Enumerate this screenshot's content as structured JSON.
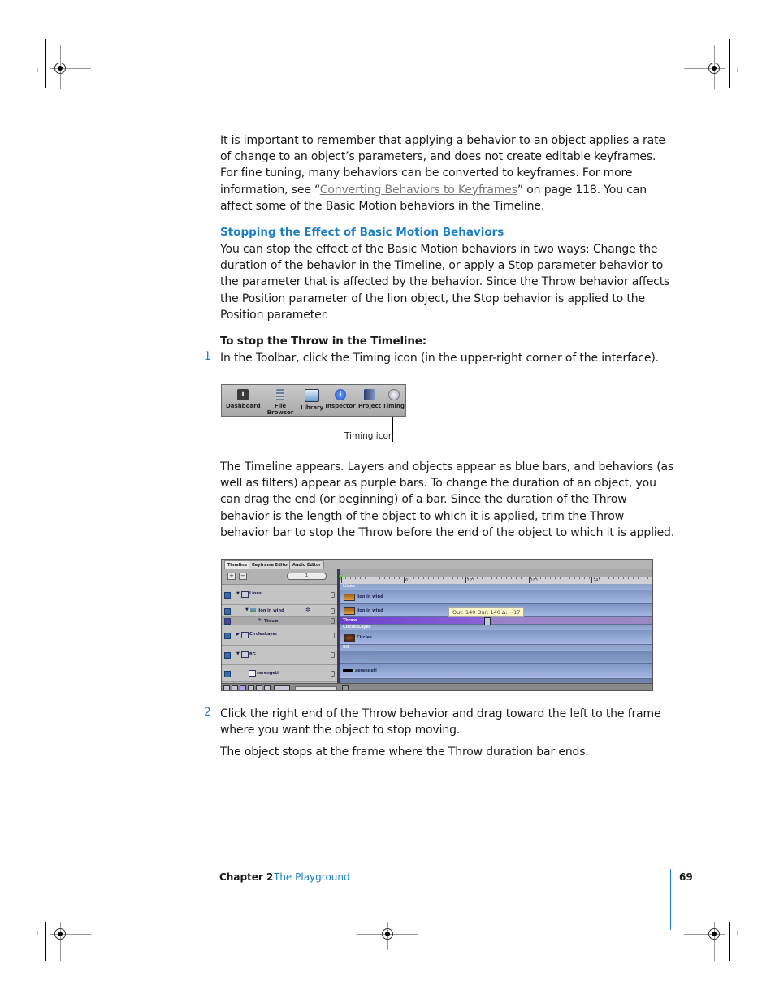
{
  "intro_paragraph": {
    "before_link": "It is important to remember that applying a behavior to an object applies a rate of change to an object’s parameters, and does not create editable keyframes. For fine tuning, many behaviors can be converted to keyframes. For more information, see “",
    "link_text": "Converting Behaviors to Keyframes",
    "after_link": "” on page 118. You can affect some of the Basic Motion behaviors in the Timeline."
  },
  "section_heading": "Stopping the Effect of Basic Motion Behaviors",
  "section_paragraph": "You can stop the effect of the Basic Motion behaviors in two ways:  Change the duration of the behavior in the Timeline, or apply a Stop parameter behavior to the parameter that is affected by the behavior. Since the Throw behavior affects the Position parameter of the lion object, the Stop behavior is applied to the Position parameter.",
  "procedure_heading": "To stop the Throw in the Timeline:",
  "steps": [
    {
      "number": "1",
      "text": "In the Toolbar, click the Timing icon (in the upper-right corner of the interface)."
    },
    {
      "number": "2",
      "text": "Click the right end of the Throw behavior and drag toward the left to the frame where you want the object to stop moving."
    }
  ],
  "toolbar_figure": {
    "items": [
      {
        "label": "Dashboard",
        "icon": "dashboard-icon",
        "color": "#3a3a3a"
      },
      {
        "label": "File Browser",
        "icon": "file-browser-icon",
        "color": "#5a6a8a"
      },
      {
        "label": "Library",
        "icon": "library-icon",
        "color": "#6a9ac8"
      },
      {
        "label": "Inspector",
        "icon": "inspector-icon",
        "color": "#2a62c8"
      },
      {
        "label": "Project",
        "icon": "project-icon",
        "color": "#3a4a7a"
      },
      {
        "label": "Timing",
        "icon": "timing-icon",
        "color": "#d0d0d8"
      }
    ],
    "callout": "Timing icon"
  },
  "timeline_paragraph": "The Timeline appears. Layers and objects appear as blue bars, and behaviors (as well as filters) appear as purple bars. To change the duration of an object, you can drag the end (or beginning) of a bar. Since the duration of the Throw behavior is the length of the object to which it is applied, trim the Throw behavior bar to stop the Throw before the end of the object to which it is applied.",
  "timeline_figure": {
    "tabs": [
      "Timeline",
      "Keyframe Editor",
      "Audio Editor"
    ],
    "add_label": "+",
    "remove_label": "−",
    "frame_field": "1",
    "ruler_labels": [
      "1",
      "61",
      "121",
      "181",
      "241"
    ],
    "layers": [
      {
        "name": "Lions",
        "indent": 0,
        "disclosure": "▼"
      },
      {
        "name": "lion in wind",
        "indent": 1,
        "disclosure": "▼"
      },
      {
        "name": "Throw",
        "indent": 2,
        "disclosure": ""
      },
      {
        "name": "CirclesLayer",
        "indent": 0,
        "disclosure": "▶"
      },
      {
        "name": "BG",
        "indent": 0,
        "disclosure": "▼"
      },
      {
        "name": "serengeti",
        "indent": 2,
        "disclosure": ""
      }
    ],
    "bars": {
      "lions_header": "Lions",
      "lion_1": "lion in wind",
      "lion_2": "lion in wind",
      "throw": "Throw",
      "circles_header": "CirclesLayer",
      "circles": "Circles",
      "bg_header": "BG",
      "bg_objects": "5 Objects",
      "serengeti": "serengeti"
    },
    "tooltip": "Out: 140 Dur: 140 Δ: −17",
    "colors": {
      "layer_bar": "#9aaedc",
      "behavior_bar": "#7a4fd4"
    }
  },
  "closing_paragraph": "The object stops at the frame where the Throw duration bar ends.",
  "footer": {
    "chapter": "Chapter 2",
    "chapter_title": "The Playground",
    "page_number": "69"
  },
  "colors": {
    "accent": "#1c7fc4",
    "link": "#7a7a7a",
    "text": "#1a1a1a"
  }
}
